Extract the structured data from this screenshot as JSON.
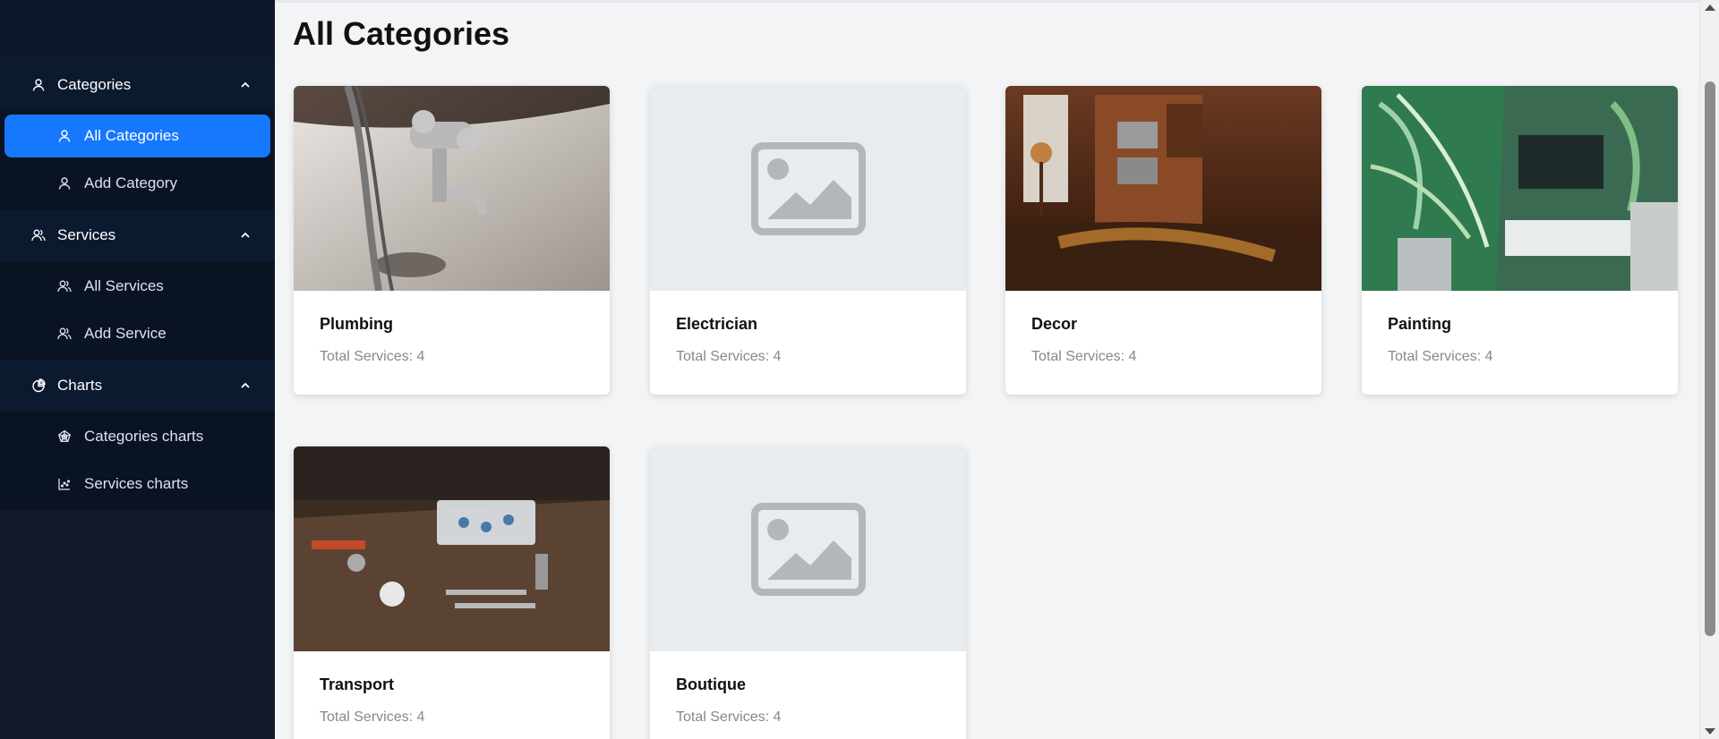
{
  "sidebar": {
    "groups": [
      {
        "label": "Categories",
        "icon": "user-icon",
        "items": [
          {
            "label": "All Categories",
            "icon": "user-icon",
            "active": true
          },
          {
            "label": "Add Category",
            "icon": "user-icon",
            "active": false
          }
        ]
      },
      {
        "label": "Services",
        "icon": "users-icon",
        "items": [
          {
            "label": "All Services",
            "icon": "users-icon",
            "active": false
          },
          {
            "label": "Add Service",
            "icon": "users-icon",
            "active": false
          }
        ]
      },
      {
        "label": "Charts",
        "icon": "pie-chart-icon",
        "items": [
          {
            "label": "Categories charts",
            "icon": "radar-chart-icon",
            "active": false
          },
          {
            "label": "Services charts",
            "icon": "dot-chart-icon",
            "active": false
          }
        ]
      }
    ]
  },
  "main": {
    "title": "All Categories",
    "cards": [
      {
        "name": "Plumbing",
        "count": "Total Services: 4",
        "image": "faucet-photo"
      },
      {
        "name": "Electrician",
        "count": "Total Services: 4",
        "image": "placeholder"
      },
      {
        "name": "Decor",
        "count": "Total Services: 4",
        "image": "kitchen-photo"
      },
      {
        "name": "Painting",
        "count": "Total Services: 4",
        "image": "living-room-photo"
      },
      {
        "name": "Transport",
        "count": "Total Services: 4",
        "image": "tools-photo"
      },
      {
        "name": "Boutique",
        "count": "Total Services: 4",
        "image": "placeholder"
      }
    ]
  },
  "colors": {
    "sidebar": "#111827",
    "active": "#1677ff",
    "background": "#f3f4f6"
  }
}
